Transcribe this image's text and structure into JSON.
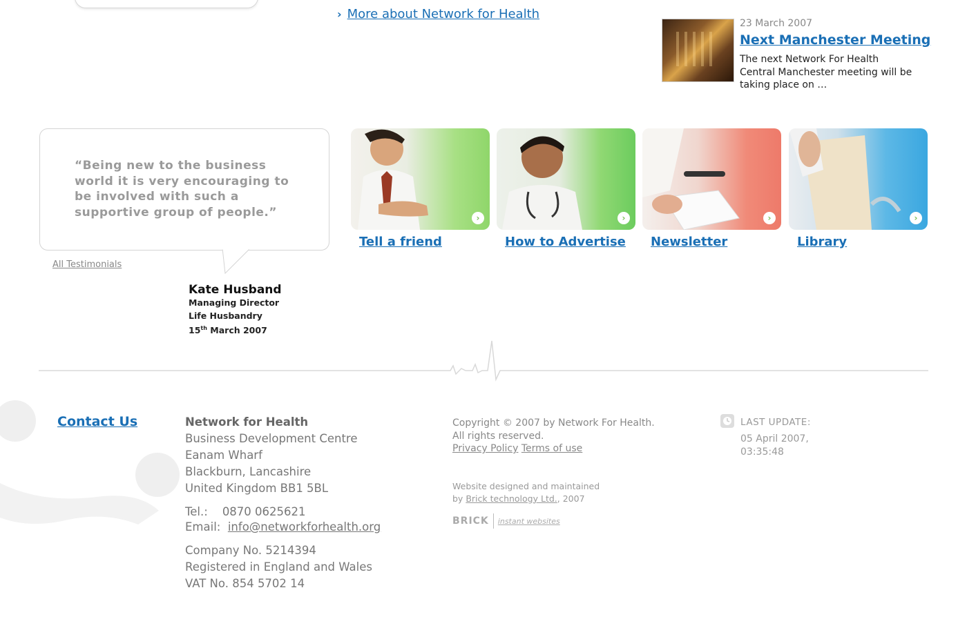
{
  "top": {
    "more_link": "More about Network for Health"
  },
  "news": {
    "date": "23 March 2007",
    "title": "Next Manchester Meeting",
    "text": "The next Network For Health Central Manchester meeting will be taking place on …"
  },
  "testimonial": {
    "quote": "“Being new to the business world it is very encouraging to be involved with such a supportive group of people.”",
    "all_link": "All Testimonials",
    "name": "Kate Husband",
    "role": "Managing Director",
    "company": "Life Husbandry",
    "date_day": "15",
    "date_suffix": "th",
    "date_rest": " March 2007"
  },
  "tiles": [
    {
      "label": "Tell a friend",
      "color": "#8fd66a"
    },
    {
      "label": "How to Advertise",
      "color": "#6ccc5e"
    },
    {
      "label": "Newsletter",
      "color": "#ee7a6a"
    },
    {
      "label": "Library",
      "color": "#3aa7e0"
    }
  ],
  "footer": {
    "contact_us": "Contact Us",
    "org_name": "Network for Health",
    "address_lines": [
      "Business Development Centre",
      "Eanam Wharf",
      "Blackburn, Lancashire",
      "United Kingdom BB1 5BL"
    ],
    "tel_label": "Tel.:",
    "tel": "0870 0625621",
    "email_label": "Email:",
    "email": "info@networkforhealth.org",
    "company_no": "Company No. 5214394",
    "registered": "Registered in England and Wales",
    "vat": "VAT No. 854 5702 14",
    "copyright": "Copyright © 2007 by Network For Health.",
    "rights": "All rights reserved.",
    "privacy": "Privacy Policy",
    "terms": "Terms of use",
    "designed_line1": "Website designed and maintained",
    "designed_by": "by",
    "designed_company": "Brick technology Ltd.",
    "designed_year": ", 2007",
    "brick_logo": "BRICK",
    "brick_tagline": "instant websites",
    "last_update_label": "LAST UPDATE:",
    "last_update_value": "05 April 2007, 03:35:48"
  }
}
